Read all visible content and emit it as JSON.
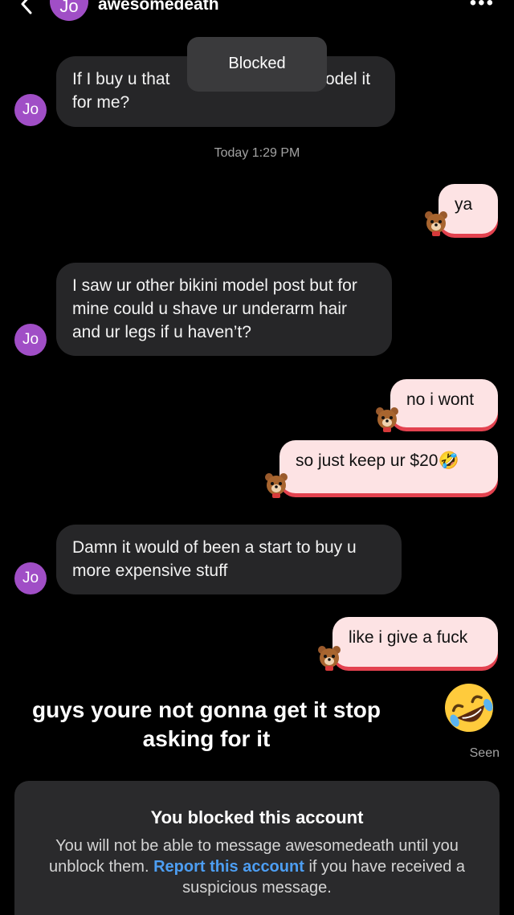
{
  "header": {
    "avatar_initials": "Jo",
    "username": "awesomedeath",
    "more_label": "•••"
  },
  "toast": {
    "label": "Blocked"
  },
  "messages": [
    {
      "from": "them",
      "text_line1": "If I buy u that",
      "text_line1_tail": "odel it",
      "text_line2": "for me?"
    },
    {
      "from": "them",
      "text": "I saw ur other bikini model post but for mine could u shave ur underarm hair and ur legs if u haven’t?"
    },
    {
      "from": "them",
      "text": "Damn it would of been a start to buy u more expensive stuff"
    }
  ],
  "timestamp": "Today 1:29 PM",
  "replies": [
    {
      "text": "ya"
    },
    {
      "text": "no i wont"
    },
    {
      "text": "so just keep ur $20🤣"
    },
    {
      "text": "like i give a fuck"
    }
  ],
  "caption": "guys youre not gonna get it stop asking for it",
  "caption_emoji": "rolling-on-floor-laughing",
  "status": {
    "seen": "Seen"
  },
  "blocked_card": {
    "title": "You blocked this account",
    "text_before": "You will not be able to message awesomedeath until you unblock them.",
    "link": "Report this account",
    "text_after": "if you have received a suspicious message."
  },
  "colors": {
    "background": "#000000",
    "avatar": "#a04ec6",
    "incoming_bubble": "#262628",
    "outgoing_bubble": "#fde3e4",
    "outgoing_accent": "#e3424f",
    "link": "#4d9ef2"
  }
}
